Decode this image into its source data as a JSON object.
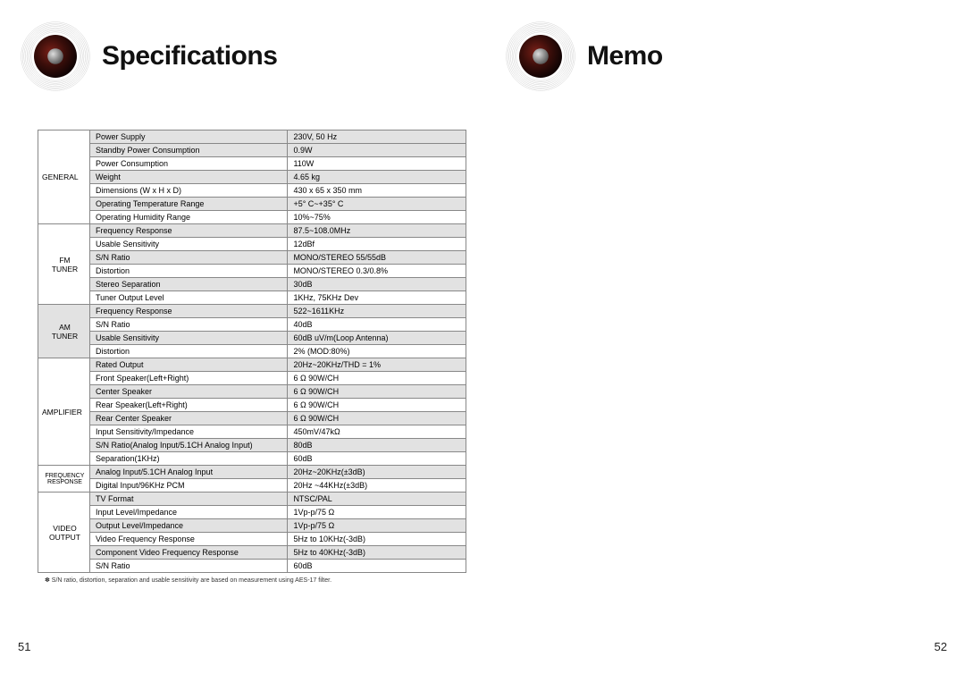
{
  "left": {
    "title": "Specifications",
    "page_num": "51",
    "footnote": "✽ S/N ratio, distortion, separation and usable sensitivity are based on measurement using AES-17 filter.",
    "categories": [
      {
        "name": "GENERAL",
        "shaded_cat": false,
        "rows": [
          {
            "name": "Power Supply",
            "value": "230V, 50 Hz",
            "shaded": true
          },
          {
            "name": "Standby Power Consumption",
            "value": "0.9W",
            "shaded": true
          },
          {
            "name": "Power Consumption",
            "value": "110W",
            "shaded": false
          },
          {
            "name": "Weight",
            "value": "4.65 kg",
            "shaded": true
          },
          {
            "name": "Dimensions (W x H x D)",
            "value": "430 x 65 x 350 mm",
            "shaded": false
          },
          {
            "name": "Operating Temperature Range",
            "value": "+5° C~+35° C",
            "shaded": true
          },
          {
            "name": "Operating Humidity Range",
            "value": "10%~75%",
            "shaded": false
          }
        ]
      },
      {
        "name": "FM TUNER",
        "shaded_cat": false,
        "rows": [
          {
            "name": "Frequency Response",
            "value": "87.5~108.0MHz",
            "shaded": true
          },
          {
            "name": "Usable Sensitivity",
            "value": "12dBf",
            "shaded": false
          },
          {
            "name": "S/N Ratio",
            "value": "MONO/STEREO 55/55dB",
            "shaded": true
          },
          {
            "name": "Distortion",
            "value": "MONO/STEREO 0.3/0.8%",
            "shaded": false
          },
          {
            "name": "Stereo Separation",
            "value": "30dB",
            "shaded": true
          },
          {
            "name": "Tuner Output Level",
            "value": "1KHz, 75KHz Dev",
            "shaded": false
          }
        ]
      },
      {
        "name": "AM TUNER",
        "shaded_cat": true,
        "rows": [
          {
            "name": "Frequency Response",
            "value": "522~1611KHz",
            "shaded": true
          },
          {
            "name": "S/N Ratio",
            "value": "40dB",
            "shaded": false
          },
          {
            "name": "Usable Sensitivity",
            "value": "60dB uV/m(Loop Antenna)",
            "shaded": true
          },
          {
            "name": "Distortion",
            "value": "2% (MOD:80%)",
            "shaded": false
          }
        ]
      },
      {
        "name": "AMPLIFIER",
        "shaded_cat": false,
        "rows": [
          {
            "name": "Rated Output",
            "value": "20Hz~20KHz/THD = 1%",
            "shaded": true
          },
          {
            "name": "Front Speaker(Left+Right)",
            "value": "6 Ω 90W/CH",
            "shaded": false
          },
          {
            "name": "Center Speaker",
            "value": "6 Ω 90W/CH",
            "shaded": true
          },
          {
            "name": "Rear Speaker(Left+Right)",
            "value": "6 Ω 90W/CH",
            "shaded": false
          },
          {
            "name": "Rear Center Speaker",
            "value": "6 Ω 90W/CH",
            "shaded": true
          },
          {
            "name": "Input Sensitivity/Impedance",
            "value": "450mV/47kΩ",
            "shaded": false
          },
          {
            "name": "S/N Ratio(Analog Input/5.1CH Analog Input)",
            "value": "80dB",
            "shaded": true
          },
          {
            "name": "Separation(1KHz)",
            "value": "60dB",
            "shaded": false
          }
        ]
      },
      {
        "name": "FREQUENCY RESPONSE",
        "shaded_cat": false,
        "small": true,
        "rows": [
          {
            "name": "Analog Input/5.1CH Analog Input",
            "value": "20Hz~20KHz(±3dB)",
            "shaded": true
          },
          {
            "name": "Digital Input/96KHz PCM",
            "value": "20Hz ~44KHz(±3dB)",
            "shaded": false
          }
        ]
      },
      {
        "name": "VIDEO OUTPUT",
        "shaded_cat": false,
        "rows": [
          {
            "name": "TV Format",
            "value": "NTSC/PAL",
            "shaded": true
          },
          {
            "name": "Input Level/Impedance",
            "value": "1Vp-p/75 Ω",
            "shaded": false
          },
          {
            "name": "Output Level/Impedance",
            "value": "1Vp-p/75 Ω",
            "shaded": true
          },
          {
            "name": "Video Frequency Response",
            "value": "5Hz to 10KHz(-3dB)",
            "shaded": false
          },
          {
            "name": "Component Video Frequency Response",
            "value": "5Hz to 40KHz(-3dB)",
            "shaded": true
          },
          {
            "name": "S/N Ratio",
            "value": "60dB",
            "shaded": false
          }
        ]
      }
    ]
  },
  "right": {
    "title": "Memo",
    "page_num": "52"
  }
}
